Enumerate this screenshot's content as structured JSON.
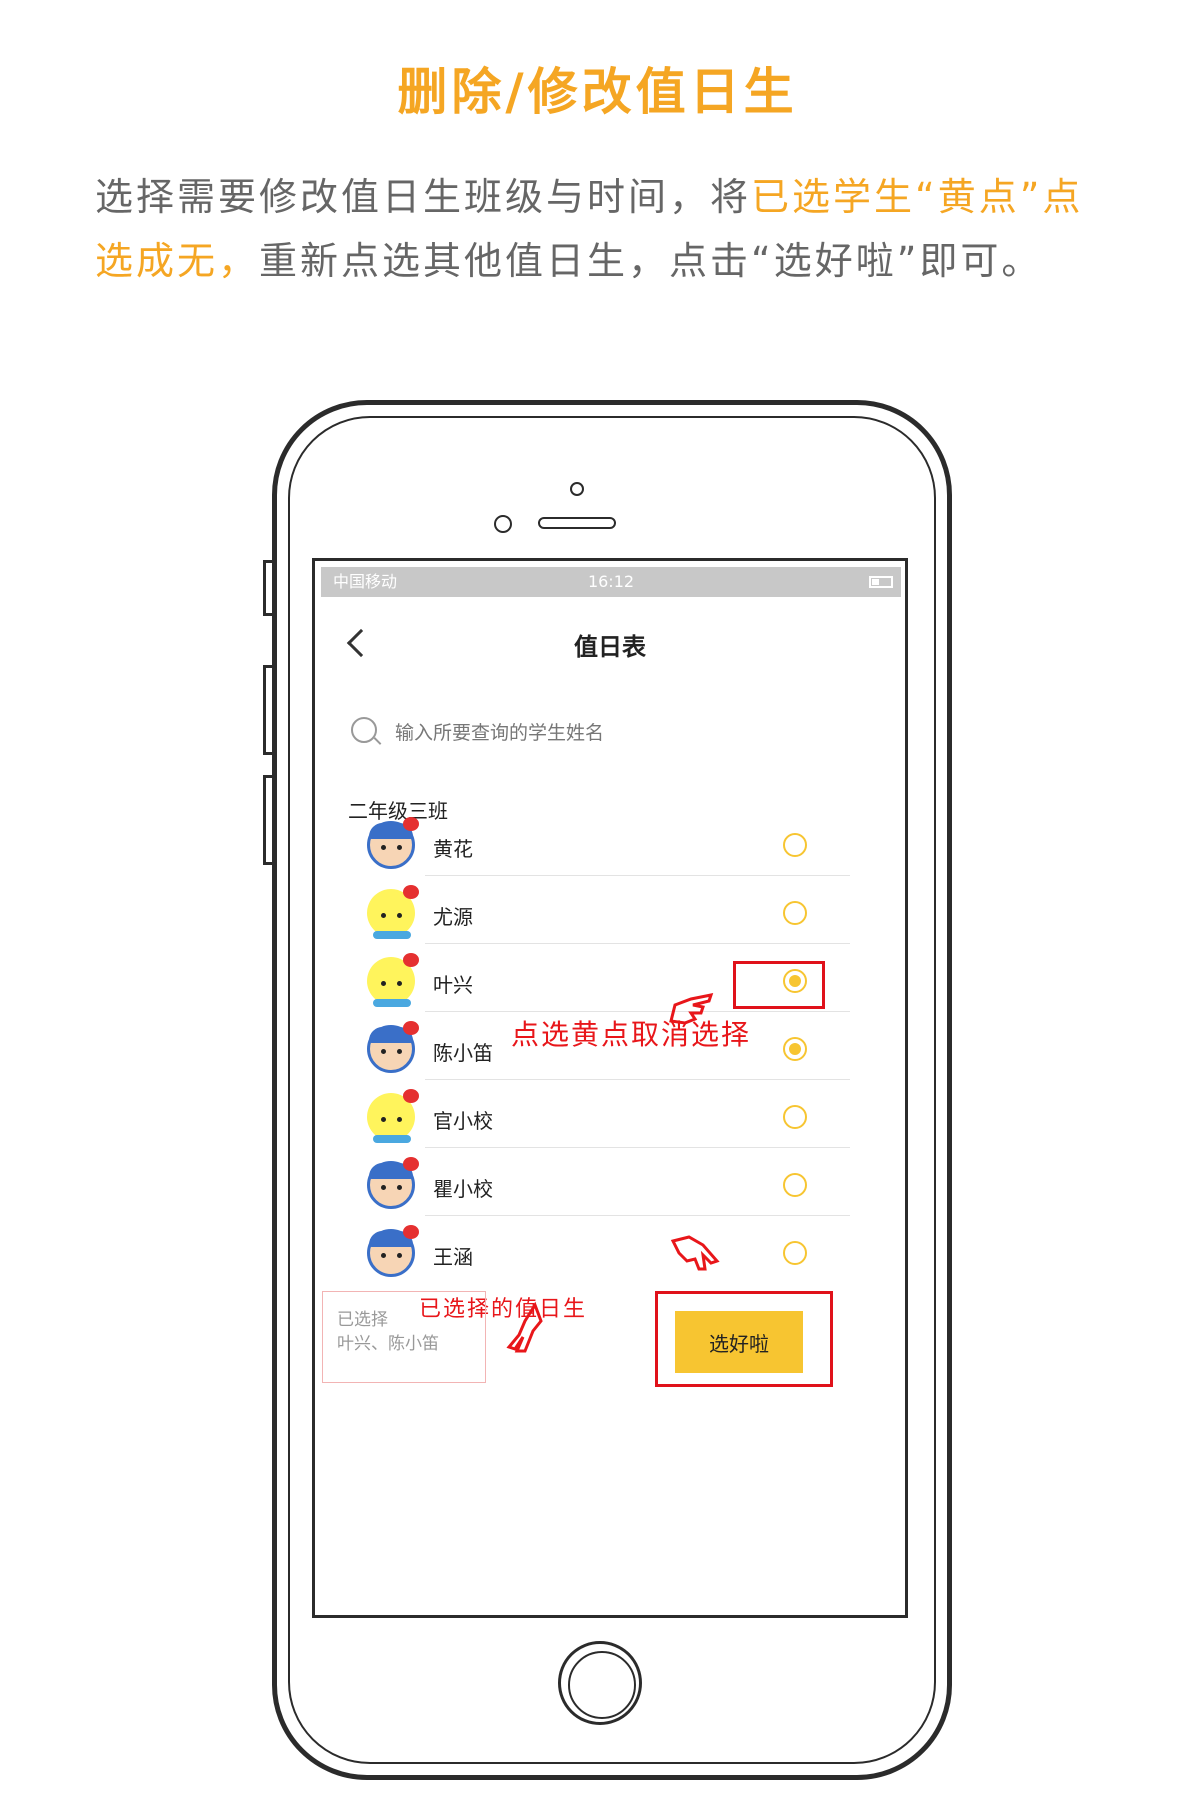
{
  "page": {
    "title": "删除/修改值日生",
    "desc_part1": "选择需要修改值日生班级与时间，将",
    "desc_hl1": "已选学生“黄点”点选成无，",
    "desc_part2": "重新点选其他值日生，点击“选好啦”即可。"
  },
  "colors": {
    "accent": "#f5a623",
    "radio": "#f7c531",
    "annotation": "#e8161a"
  },
  "status_bar": {
    "left": "中国移动",
    "time": "16:12"
  },
  "nav": {
    "title": "值日表",
    "back_icon": "chevron-left-icon"
  },
  "search": {
    "placeholder": "输入所要查询的学生姓名"
  },
  "class_name": "二年级三班",
  "students": [
    {
      "name": "黄花",
      "selected": false,
      "avatar": "girl"
    },
    {
      "name": "尤源",
      "selected": false,
      "avatar": "chick"
    },
    {
      "name": "叶兴",
      "selected": true,
      "avatar": "chick"
    },
    {
      "name": "陈小笛",
      "selected": true,
      "avatar": "girl"
    },
    {
      "name": "官小校",
      "selected": false,
      "avatar": "chick"
    },
    {
      "name": "瞿小校",
      "selected": false,
      "avatar": "girl"
    },
    {
      "name": "王涵",
      "selected": false,
      "avatar": "girl"
    }
  ],
  "footer": {
    "selected_label": "已选择",
    "selected_names": "叶兴、陈小笛",
    "confirm": "选好啦"
  },
  "annotations": {
    "cancel_note": "点选黄点取消选择",
    "selected_note": "已选择的值日生"
  }
}
